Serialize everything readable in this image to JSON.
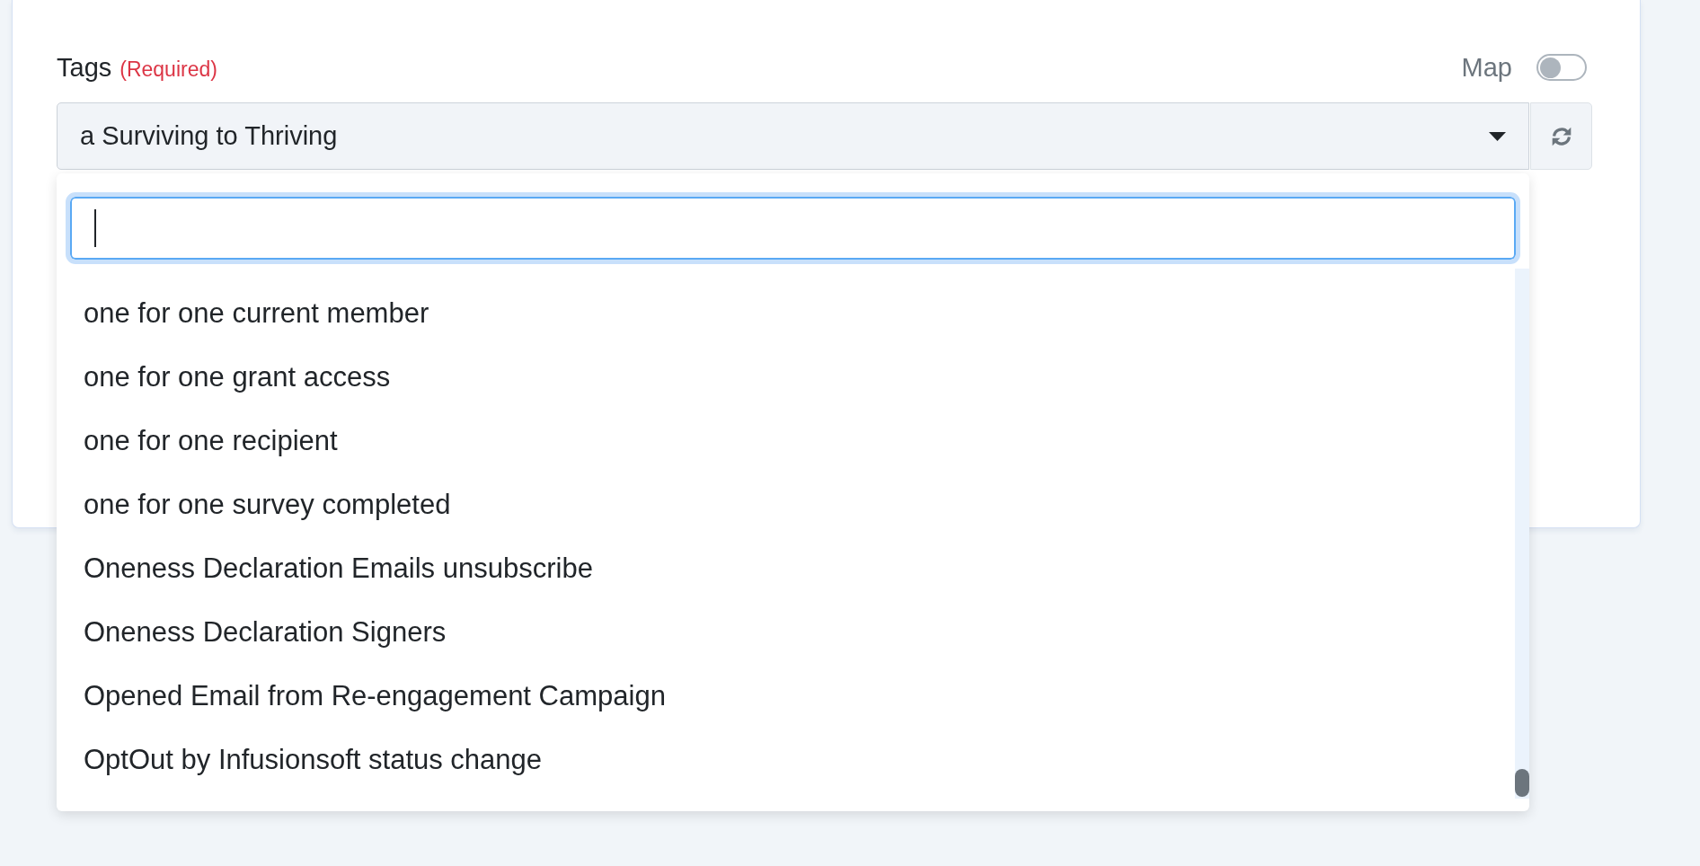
{
  "field": {
    "label": "Tags",
    "required_note": "(Required)"
  },
  "map_toggle": {
    "label": "Map",
    "on": false
  },
  "select": {
    "value": "a Surviving to Thriving",
    "expanded": true
  },
  "dropdown": {
    "search": {
      "focused": true
    },
    "options": [
      {
        "label": "one for one current member",
        "selected": false
      },
      {
        "label": "one for one grant access",
        "selected": false
      },
      {
        "label": "one for one recipient",
        "selected": false
      },
      {
        "label": "one for one survey completed",
        "selected": false
      },
      {
        "label": "Oneness Declaration Emails unsubscribe",
        "selected": false
      },
      {
        "label": "Oneness Declaration Signers",
        "selected": false
      },
      {
        "label": "Opened Email from Re-engagement Campaign",
        "selected": false
      },
      {
        "label": "OptOut by Infusionsoft status change",
        "selected": false
      }
    ]
  }
}
